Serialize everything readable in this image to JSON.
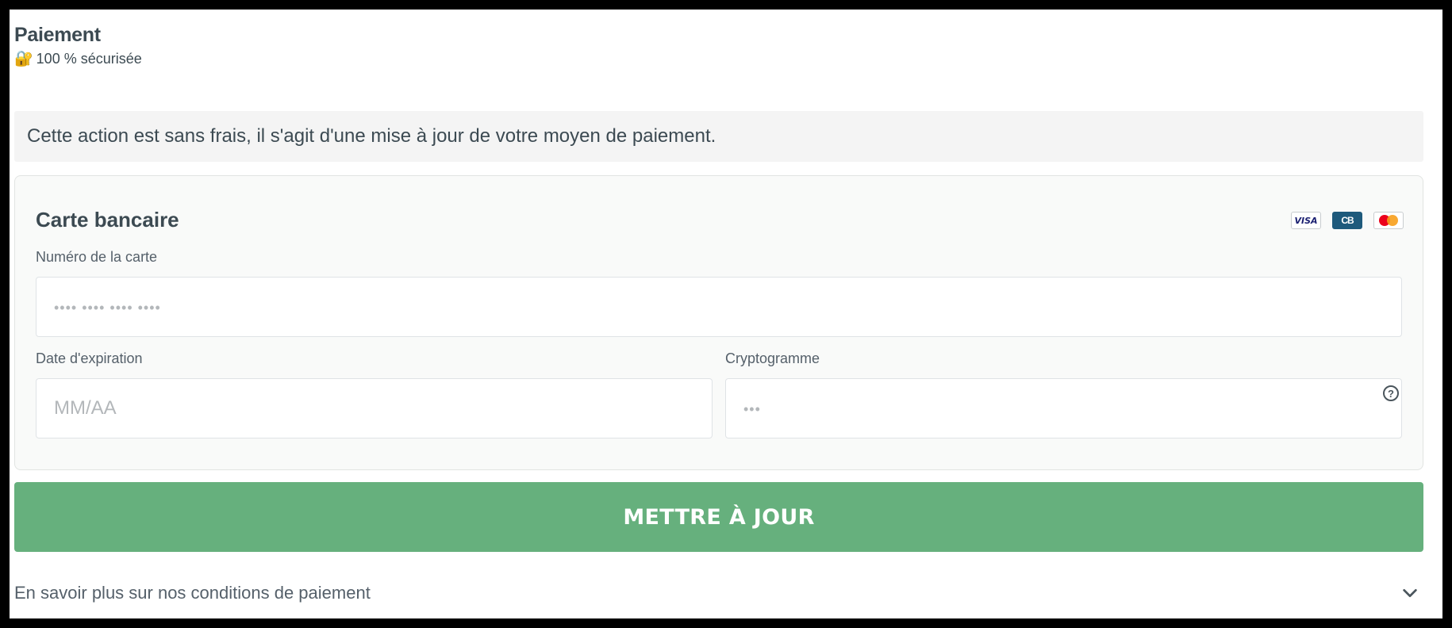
{
  "header": {
    "title": "Paiement",
    "lock_icon": "🔐",
    "secure_text": "100 % sécurisée"
  },
  "notice": {
    "text": "Cette action est sans frais, il s'agit d'une mise à jour de votre moyen de paiement."
  },
  "card": {
    "title": "Carte bancaire",
    "brands": [
      {
        "name": "visa-icon",
        "label": "VISA"
      },
      {
        "name": "cb-icon",
        "label": "CB"
      },
      {
        "name": "mastercard-icon",
        "label": ""
      }
    ],
    "number_label": "Numéro de la carte",
    "number_placeholder": "•••• •••• •••• ••••",
    "expiry_label": "Date d'expiration",
    "expiry_placeholder": "MM/AA",
    "cvc_label": "Cryptogramme",
    "cvc_placeholder": "•••",
    "help_icon": "?"
  },
  "actions": {
    "submit_label": "METTRE À JOUR"
  },
  "footer": {
    "more_label": "En savoir plus sur nos conditions de paiement"
  },
  "colors": {
    "accent": "#66b07d",
    "text": "#3c4a52",
    "notice_bg": "#f4f4f4"
  }
}
